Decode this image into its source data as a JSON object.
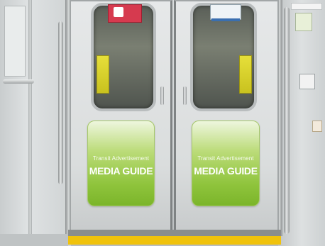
{
  "scene": {
    "description_colors": {
      "ad_green": "#8fc43c",
      "floor_strip_yellow": "#f0c20b",
      "sticker_red": "#d63a4f"
    },
    "ads": [
      {
        "subtitle": "Transit Advertisement",
        "title": "MEDIA GUIDE"
      },
      {
        "subtitle": "Transit Advertisement",
        "title": "MEDIA GUIDE"
      }
    ]
  }
}
